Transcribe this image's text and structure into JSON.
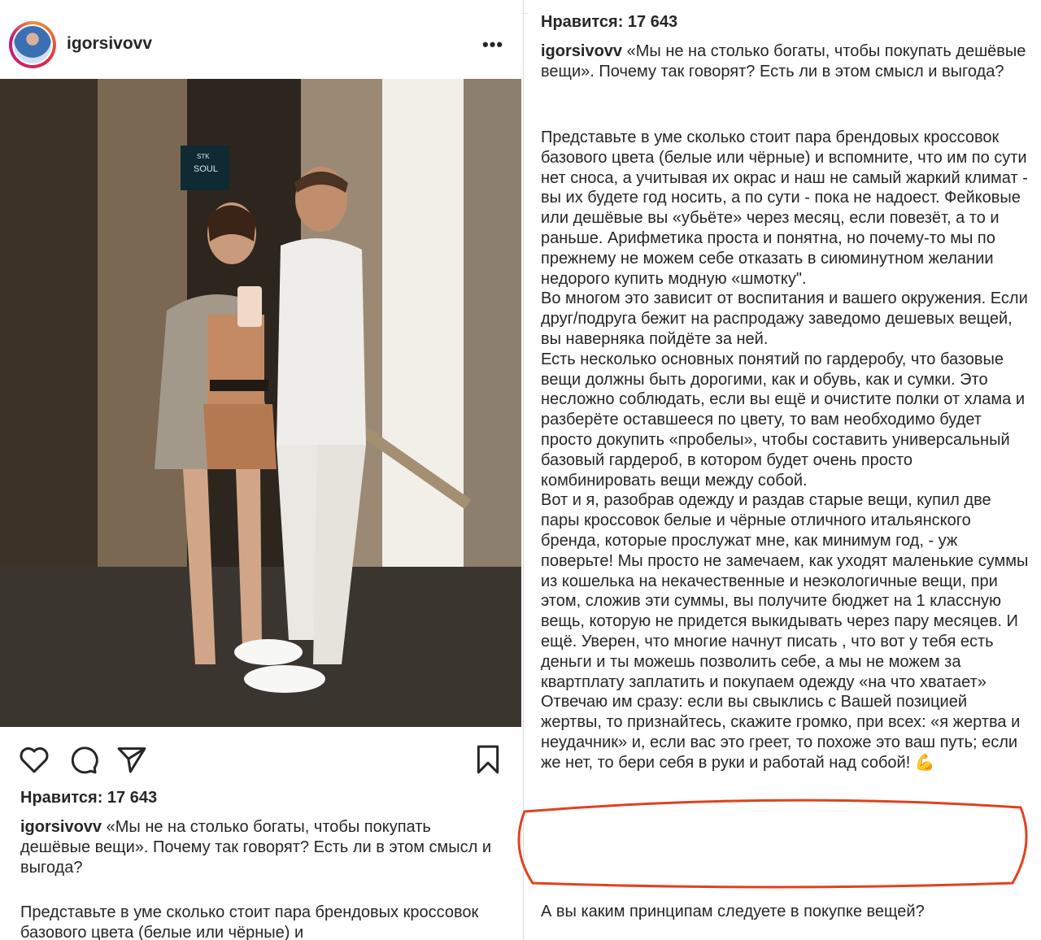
{
  "post": {
    "username": "igorsivovv",
    "more_label": "•••",
    "likes": "Нравится: 17 643",
    "caption_title": "«Мы не на столько богаты, чтобы покупать дешёвые вещи». Почему так говорят? Есть ли в этом смысл и выгода?",
    "body_preview": "Представьте в уме сколько стоит пара брендовых кроссовок базового цвета (белые или чёрные) и",
    "paragraphs": [
      "Представьте в уме сколько стоит пара брендовых кроссовок базового цвета (белые или чёрные) и вспомните, что им по сути нет сноса, а учитывая их окрас и наш не самый жаркий климат - вы их будете год носить, а по сути - пока не надоест. Фейковые или дешёвые вы «убьёте» через месяц, если повезёт, а то и раньше. Арифметика проста и понятна, но почему-то мы по прежнему не можем себе отказать в сиюминутном желании недорого купить модную «шмотку\".",
      "Во многом это зависит от воспитания и вашего окружения. Если друг/подруга бежит на распродажу заведомо дешевых вещей, вы наверняка пойдёте за ней.",
      "Есть несколько основных понятий по гардеробу, что базовые вещи должны быть дорогими, как и обувь, как и сумки. Это несложно соблюдать, если вы ещё и очистите полки от хлама и разберёте оставшееся по цвету, то вам необходимо будет просто докупить «пробелы», чтобы составить универсальный базовый гардероб, в котором будет очень просто комбинировать вещи между собой.",
      "Вот и я, разобрав одежду и раздав старые вещи, купил две пары кроссовок белые и чёрные отличного итальянского бренда, которые прослужат мне, как минимум год, - уж поверьте! Мы просто не замечаем, как уходят маленькие суммы из кошелька на некачественные и неэкологичные вещи, при этом, сложив эти суммы, вы получите бюджет на 1 классную вещь, которую не придется выкидывать через пару месяцев. И ещё. Уверен, что многие начнут писать , что вот у тебя есть деньги и ты можешь позволить себе, а мы не можем за квартплату заплатить и покупаем одежду «на что хватает» Отвечаю им сразу: если вы свыклись с Вашей позицией жертвы, то признайтесь, скажите громко, при всех: «я жертва и неудачник» и, если вас это греет, то похоже это ваш путь; если же нет, то бери себя в руки и работай над собой! 💪"
    ],
    "closing_question": "А вы каким принципам следуете в покупке вещей?"
  },
  "photo": {
    "elevator_sign_line1": "STK",
    "elevator_sign_line2": "SOUL"
  },
  "icons": {
    "like": "heart-icon",
    "comment": "comment-icon",
    "share": "paper-plane-icon",
    "save": "bookmark-icon",
    "more": "more-horizontal-icon"
  },
  "colors": {
    "highlight": "#e0421f",
    "text": "#262626"
  }
}
